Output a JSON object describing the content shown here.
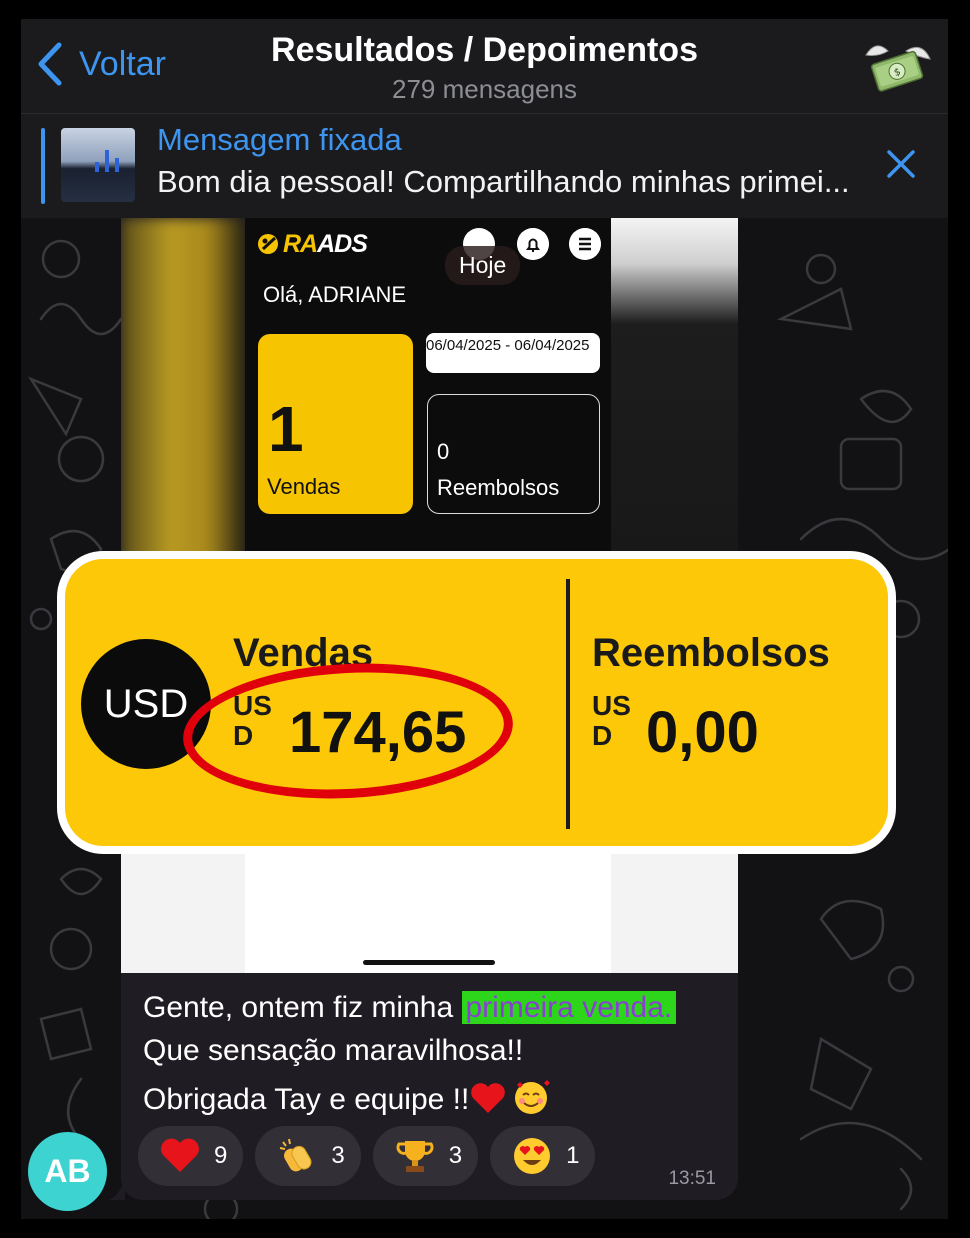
{
  "header": {
    "back_label": "Voltar",
    "title": "Resultados / Depoimentos",
    "subtitle": "279 mensagens"
  },
  "pinned": {
    "title": "Mensagem fixada",
    "text": "Bom dia pessoal! Compartilhando minhas primei..."
  },
  "screenshot": {
    "brand_a": "RA",
    "brand_b": "ADS",
    "date_badge": "Hoje",
    "greeting": "Olá, ADRIANE",
    "sales_count": "1",
    "sales_label": "Vendas",
    "date_range": "06/04/2025 - 06/04/2025",
    "refunds_count": "0",
    "refunds_label": "Reembolsos"
  },
  "zoom": {
    "currency_badge": "USD",
    "sales_title": "Vendas",
    "sales_currency": "US D",
    "sales_value": "174,65",
    "refunds_title": "Reembolsos",
    "refunds_currency": "US D",
    "refunds_value": "0,00"
  },
  "message": {
    "line1_prefix": "Gente, ontem fiz minha",
    "line1_highlight": "primeira venda.",
    "line2": "Que sensação maravilhosa!!",
    "line3": "Obrigada Tay e equipe !!",
    "time": "13:51",
    "sender_initials": "AB",
    "highlight_bg": "#2ed61b",
    "highlight_fg": "#8b3dd6"
  },
  "reactions": [
    {
      "icon": "heart-icon",
      "count": "9"
    },
    {
      "icon": "clap-icon",
      "count": "3"
    },
    {
      "icon": "trophy-icon",
      "count": "3"
    },
    {
      "icon": "heart-eyes-icon",
      "count": "1"
    }
  ]
}
